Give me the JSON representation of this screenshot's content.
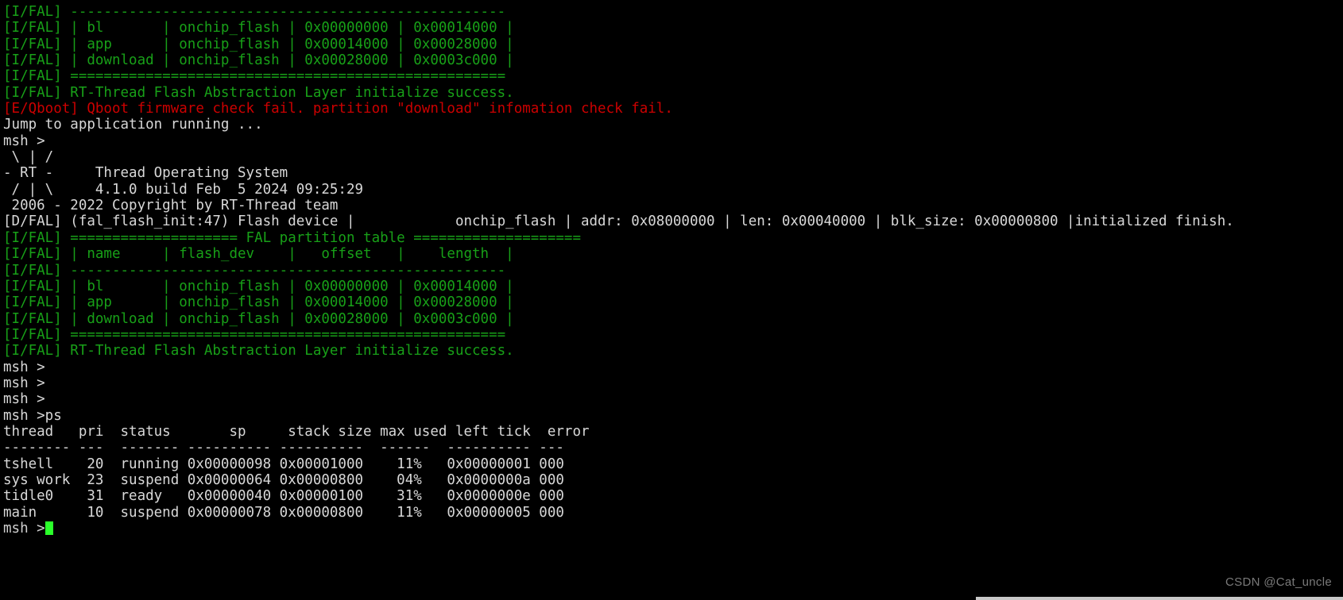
{
  "terminal": {
    "title": "RT-Thread MSH serial console",
    "background_color": "#000000",
    "default_text_color": "#d8d8d8",
    "log_info_color": "#18a018",
    "log_error_color": "#cc0000",
    "cursor_color": "#2aff2a",
    "prompt": "msh >",
    "command_entered": "ps",
    "lines": [
      {
        "text": "[I/FAL] ----------------------------------------------------",
        "color": "green"
      },
      {
        "text": "[I/FAL] | bl       | onchip_flash | 0x00000000 | 0x00014000 |",
        "color": "green"
      },
      {
        "text": "[I/FAL] | app      | onchip_flash | 0x00014000 | 0x00028000 |",
        "color": "green"
      },
      {
        "text": "[I/FAL] | download | onchip_flash | 0x00028000 | 0x0003c000 |",
        "color": "green"
      },
      {
        "text": "[I/FAL] ====================================================",
        "color": "green"
      },
      {
        "text": "[I/FAL] RT-Thread Flash Abstraction Layer initialize success.",
        "color": "green"
      },
      {
        "text": "[E/Qboot] Qboot firmware check fail. partition \"download\" infomation check fail.",
        "color": "red"
      },
      {
        "text": "Jump to application running ...",
        "color": "white"
      },
      {
        "text": "msh >",
        "color": "white"
      },
      {
        "text": " \\ | /",
        "color": "white"
      },
      {
        "text": "- RT -     Thread Operating System",
        "color": "white"
      },
      {
        "text": " / | \\     4.1.0 build Feb  5 2024 09:25:29",
        "color": "white"
      },
      {
        "text": " 2006 - 2022 Copyright by RT-Thread team",
        "color": "white"
      },
      {
        "text": "[D/FAL] (fal_flash_init:47) Flash device |            onchip_flash | addr: 0x08000000 | len: 0x00040000 | blk_size: 0x00000800 |initialized finish.",
        "color": "white"
      },
      {
        "text": "[I/FAL] ==================== FAL partition table ====================",
        "color": "green"
      },
      {
        "text": "[I/FAL] | name     | flash_dev    |   offset   |    length  |",
        "color": "green"
      },
      {
        "text": "[I/FAL] ----------------------------------------------------",
        "color": "green"
      },
      {
        "text": "[I/FAL] | bl       | onchip_flash | 0x00000000 | 0x00014000 |",
        "color": "green"
      },
      {
        "text": "[I/FAL] | app      | onchip_flash | 0x00014000 | 0x00028000 |",
        "color": "green"
      },
      {
        "text": "[I/FAL] | download | onchip_flash | 0x00028000 | 0x0003c000 |",
        "color": "green"
      },
      {
        "text": "[I/FAL] ====================================================",
        "color": "green"
      },
      {
        "text": "[I/FAL] RT-Thread Flash Abstraction Layer initialize success.",
        "color": "green"
      },
      {
        "text": "msh >",
        "color": "white"
      },
      {
        "text": "msh >",
        "color": "white"
      },
      {
        "text": "msh >",
        "color": "white"
      },
      {
        "text": "msh >ps",
        "color": "white"
      },
      {
        "text": "thread   pri  status       sp     stack size max used left tick  error",
        "color": "white"
      },
      {
        "text": "-------- ---  ------- ---------- ----------  ------  ---------- ---",
        "color": "white"
      },
      {
        "text": "tshell    20  running 0x00000098 0x00001000    11%   0x00000001 000",
        "color": "white"
      },
      {
        "text": "sys work  23  suspend 0x00000064 0x00000800    04%   0x0000000a 000",
        "color": "white"
      },
      {
        "text": "tidle0    31  ready   0x00000040 0x00000100    31%   0x0000000e 000",
        "color": "white"
      },
      {
        "text": "main      10  suspend 0x00000078 0x00000800    11%   0x00000005 000",
        "color": "white"
      }
    ],
    "final_prompt": "msh >"
  },
  "ps_table": {
    "command": "ps",
    "headers": [
      "thread",
      "pri",
      "status",
      "sp",
      "stack size",
      "max used",
      "left tick",
      "error"
    ],
    "separator_row": [
      "--------",
      "---",
      "-------",
      "----------",
      "----------",
      "------",
      "----------",
      "---"
    ],
    "rows": [
      [
        "tshell",
        "20",
        "running",
        "0x00000098",
        "0x00001000",
        "11%",
        "0x00000001",
        "000"
      ],
      [
        "sys work",
        "23",
        "suspend",
        "0x00000064",
        "0x00000800",
        "04%",
        "0x0000000a",
        "000"
      ],
      [
        "tidle0",
        "31",
        "ready",
        "0x00000040",
        "0x00000100",
        "31%",
        "0x0000000e",
        "000"
      ],
      [
        "main",
        "10",
        "suspend",
        "0x00000078",
        "0x00000800",
        "11%",
        "0x00000005",
        "000"
      ]
    ]
  },
  "fal_partition_table": {
    "title": "FAL partition table",
    "headers": [
      "name",
      "flash_dev",
      "offset",
      "length"
    ],
    "rows": [
      [
        "bl",
        "onchip_flash",
        "0x00000000",
        "0x00014000"
      ],
      [
        "app",
        "onchip_flash",
        "0x00014000",
        "0x00028000"
      ],
      [
        "download",
        "onchip_flash",
        "0x00028000",
        "0x0003c000"
      ]
    ],
    "init_message": "RT-Thread Flash Abstraction Layer initialize success."
  },
  "flash_device": {
    "name": "onchip_flash",
    "addr": "0x08000000",
    "len": "0x00040000",
    "blk_size": "0x00000800",
    "status": "initialized finish.",
    "source": "(fal_flash_init:47)"
  },
  "rt_thread_banner": {
    "os_name": "Thread Operating System",
    "version": "4.1.0",
    "build": "build Feb  5 2024 09:25:29",
    "copyright": "2006 - 2022 Copyright by RT-Thread team"
  },
  "qboot": {
    "error": "[E/Qboot] Qboot firmware check fail. partition \"download\" infomation check fail.",
    "jump_message": "Jump to application running ..."
  },
  "watermark": {
    "text": "CSDN @Cat_uncle"
  }
}
